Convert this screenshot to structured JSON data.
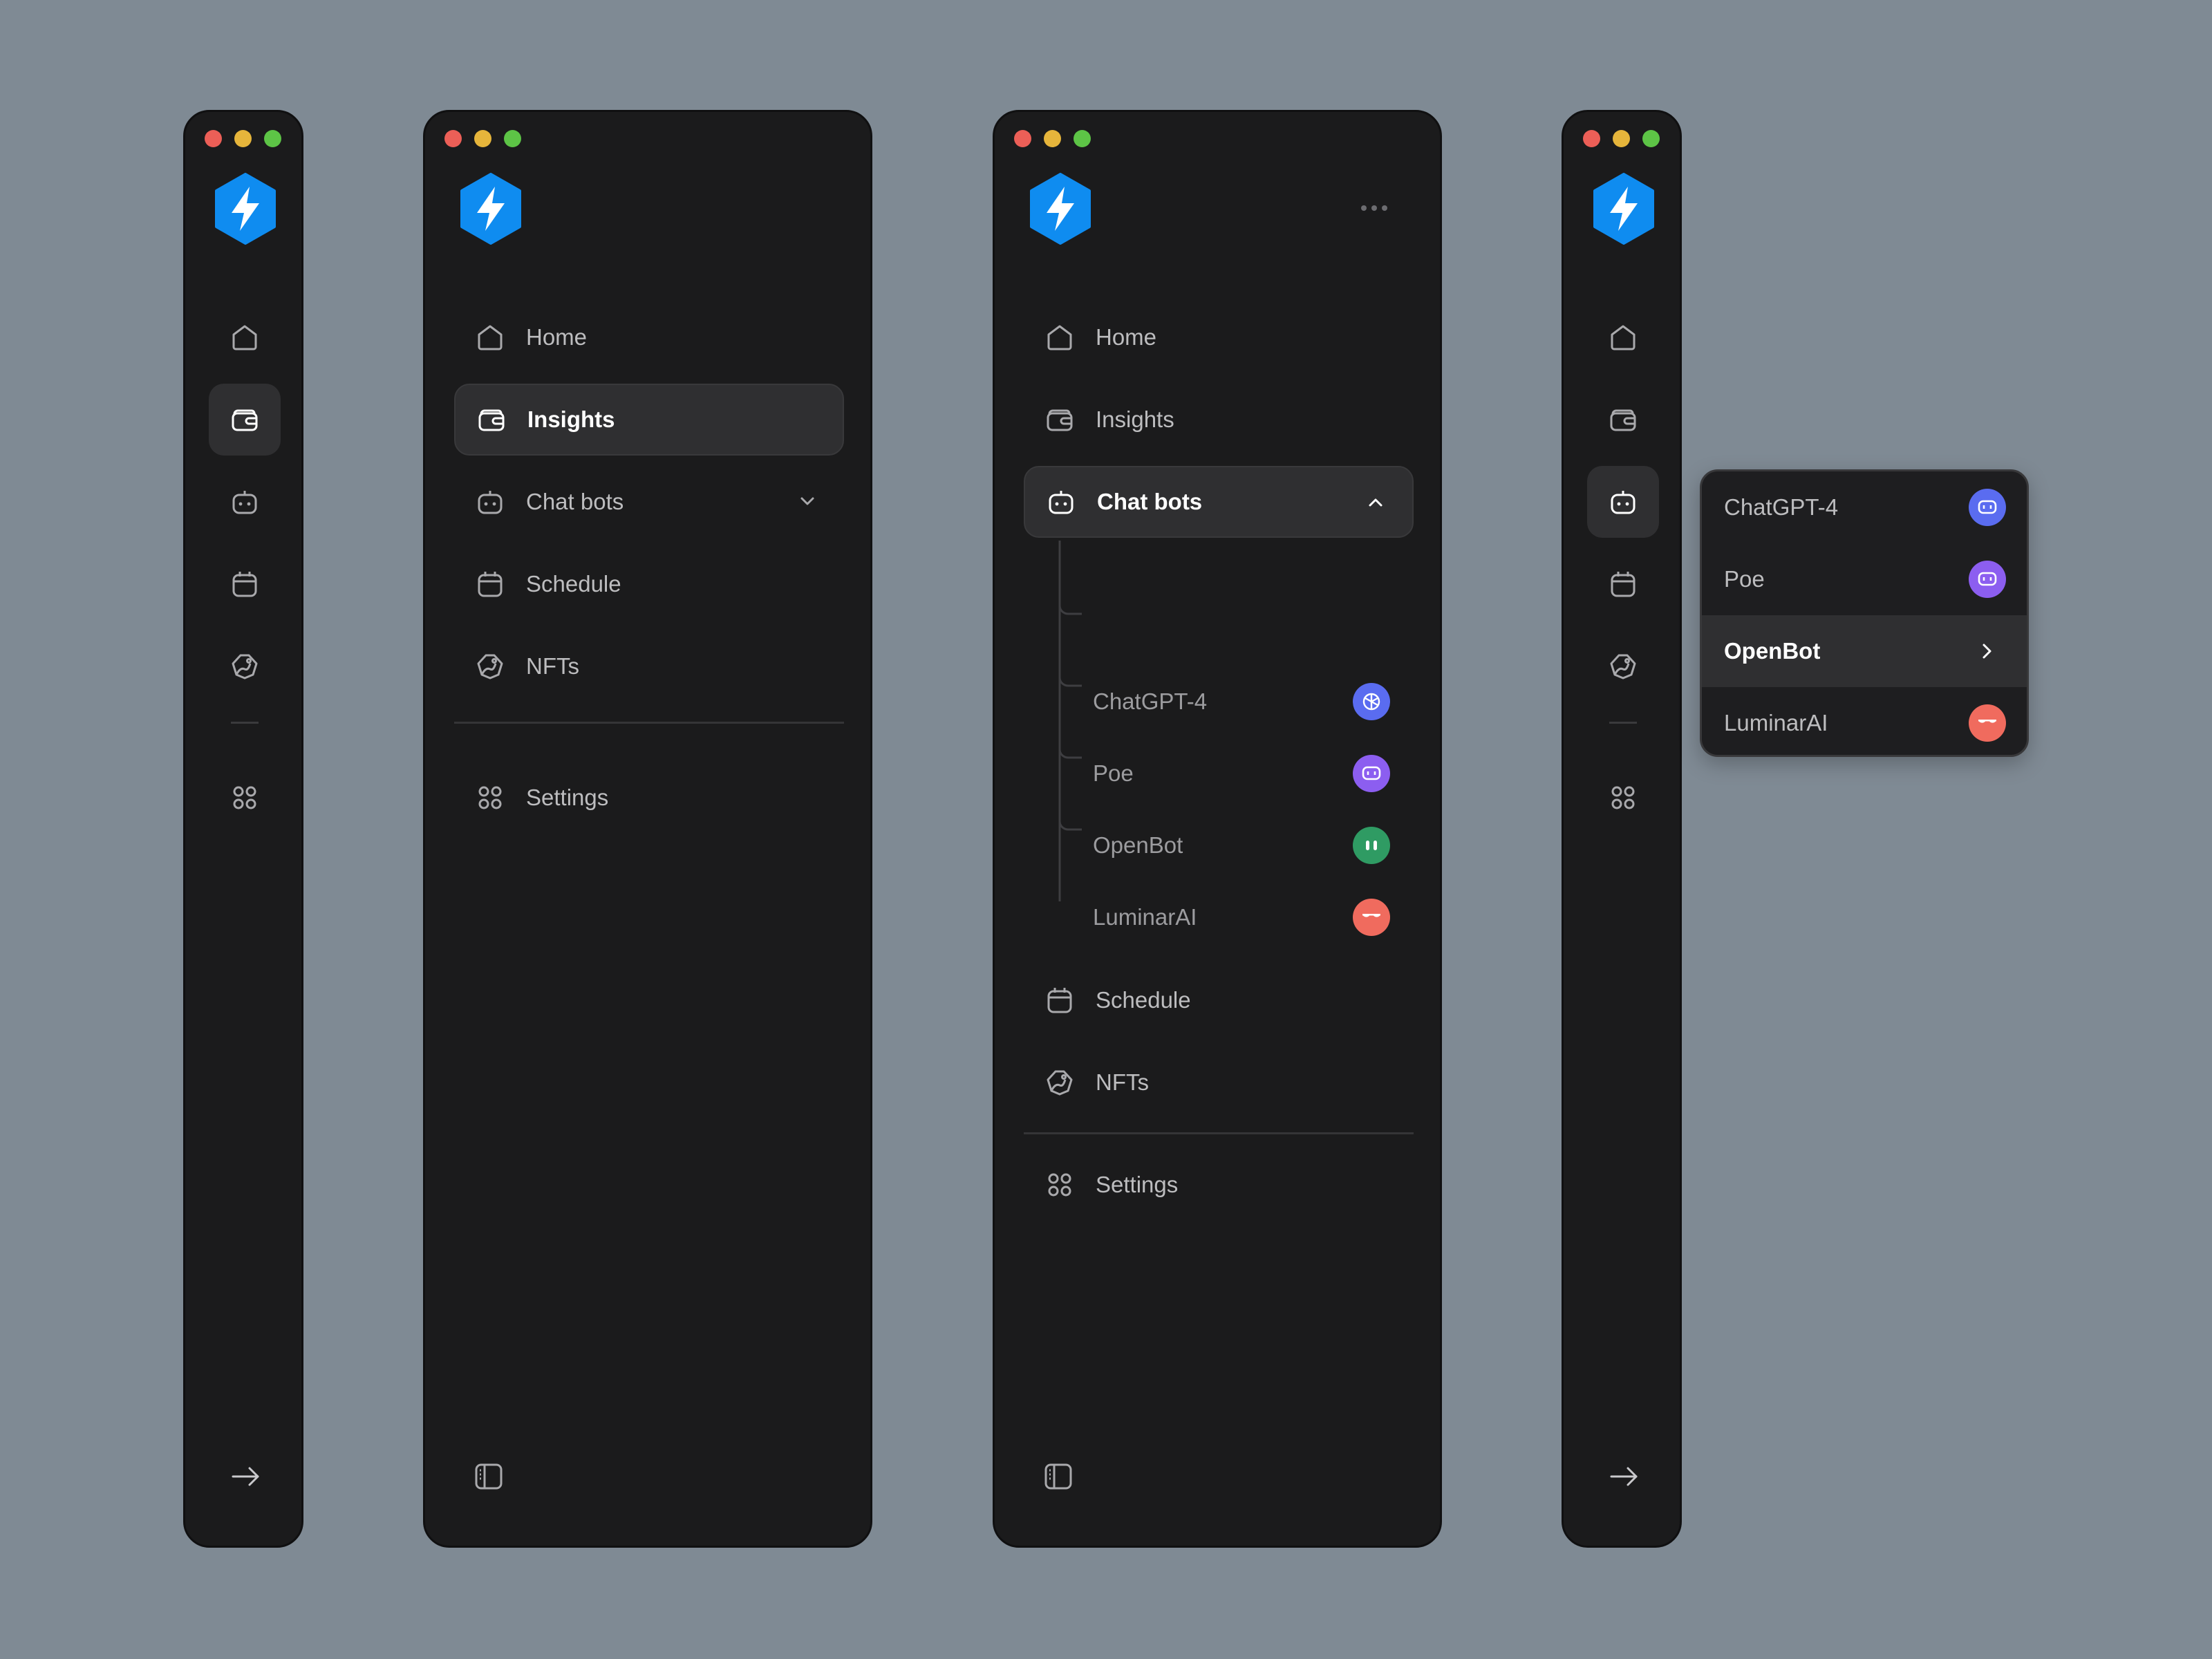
{
  "nav": {
    "home": "Home",
    "insights": "Insights",
    "chatbots": "Chat bots",
    "schedule": "Schedule",
    "nfts": "NFTs",
    "settings": "Settings"
  },
  "bots": [
    {
      "label": "ChatGPT-4",
      "color": "#5a6cf0",
      "icon": "openai-icon"
    },
    {
      "label": "Poe",
      "color": "#8c5ef0",
      "icon": "chat-bubble-icon"
    },
    {
      "label": "OpenBot",
      "color": "#2f9b63",
      "icon": "robot-eyes-icon"
    },
    {
      "label": "LuminarAI",
      "color": "#f06b5e",
      "icon": "sunglasses-icon"
    }
  ],
  "colors": {
    "background": "#7f8a94",
    "panel": "#1b1b1c",
    "active_item": "#2f2f31",
    "brand": "#0f8cf0"
  }
}
